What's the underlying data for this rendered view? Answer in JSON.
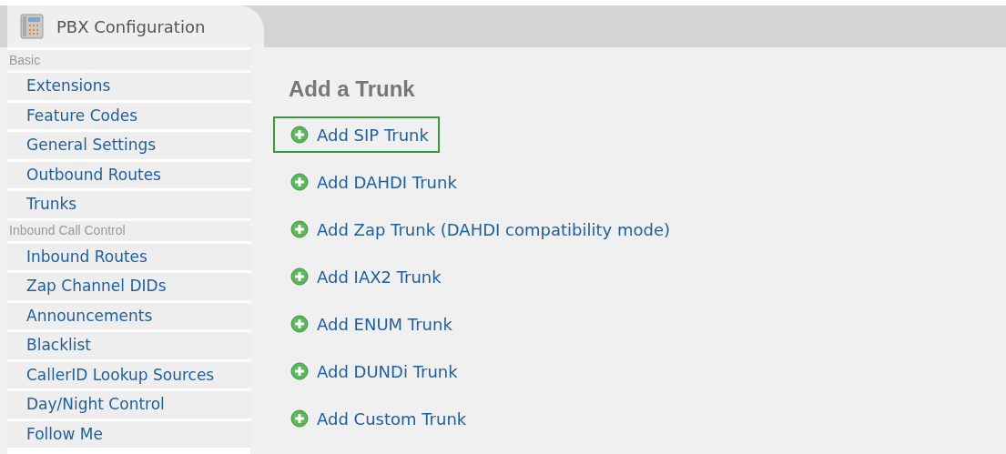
{
  "tab": {
    "label": "PBX Configuration",
    "selected": true
  },
  "sidebar": {
    "sections": [
      {
        "title": "Basic",
        "items": [
          {
            "label": "Extensions"
          },
          {
            "label": "Feature Codes"
          },
          {
            "label": "General Settings"
          },
          {
            "label": "Outbound Routes"
          },
          {
            "label": "Trunks"
          }
        ]
      },
      {
        "title": "Inbound Call Control",
        "items": [
          {
            "label": "Inbound Routes"
          },
          {
            "label": "Zap Channel DIDs"
          },
          {
            "label": "Announcements"
          },
          {
            "label": "Blacklist"
          },
          {
            "label": "CallerID Lookup Sources"
          },
          {
            "label": "Day/Night Control"
          },
          {
            "label": "Follow Me"
          }
        ]
      }
    ]
  },
  "heading": "Add a Trunk",
  "links": [
    {
      "label": "Add SIP Trunk",
      "selected": true
    },
    {
      "label": "Add DAHDI Trunk",
      "selected": false
    },
    {
      "label": "Add Zap Trunk (DAHDI compatibility mode)",
      "selected": false
    },
    {
      "label": "Add IAX2 Trunk",
      "selected": false
    },
    {
      "label": "Add ENUM Trunk",
      "selected": false
    },
    {
      "label": "Add DUNDi Trunk",
      "selected": false
    },
    {
      "label": "Add Custom Trunk",
      "selected": false
    }
  ]
}
